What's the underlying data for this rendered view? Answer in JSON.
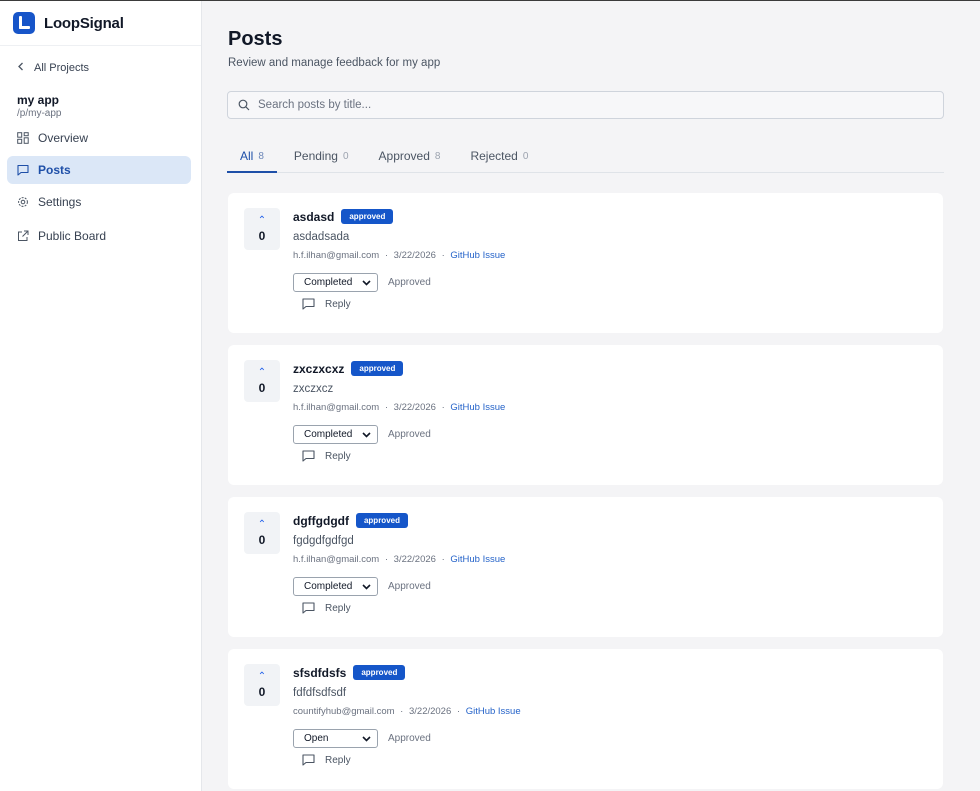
{
  "brand": {
    "name": "LoopSignal",
    "accent": "#1755c9"
  },
  "sidebar": {
    "back_label": "All Projects",
    "project_name": "my app",
    "project_path": "/p/my-app",
    "items": [
      {
        "label": "Overview",
        "icon": "grid-icon"
      },
      {
        "label": "Posts",
        "icon": "message-square-icon"
      },
      {
        "label": "Settings",
        "icon": "gear-icon"
      },
      {
        "label": "Public Board",
        "icon": "external-link-icon"
      }
    ]
  },
  "header": {
    "title": "Posts",
    "subtitle": "Review and manage feedback for my app"
  },
  "search": {
    "placeholder": "Search posts by title..."
  },
  "tabs": [
    {
      "label": "All",
      "count": "8"
    },
    {
      "label": "Pending",
      "count": "0"
    },
    {
      "label": "Approved",
      "count": "8"
    },
    {
      "label": "Rejected",
      "count": "0"
    }
  ],
  "posts": [
    {
      "votes": "0",
      "title": "asdasd",
      "badge": "approved",
      "body": "asdadsada",
      "author": "h.f.ilhan@gmail.com",
      "date": "3/22/2026",
      "link": "GitHub Issue",
      "status": "Completed",
      "approval": "Approved",
      "reply": "Reply"
    },
    {
      "votes": "0",
      "title": "zxczxcxz",
      "badge": "approved",
      "body": "zxczxcz",
      "author": "h.f.ilhan@gmail.com",
      "date": "3/22/2026",
      "link": "GitHub Issue",
      "status": "Completed",
      "approval": "Approved",
      "reply": "Reply"
    },
    {
      "votes": "0",
      "title": "dgffgdgdf",
      "badge": "approved",
      "body": "fgdgdfgdfgd",
      "author": "h.f.ilhan@gmail.com",
      "date": "3/22/2026",
      "link": "GitHub Issue",
      "status": "Completed",
      "approval": "Approved",
      "reply": "Reply"
    },
    {
      "votes": "0",
      "title": "sfsdfdsfs",
      "badge": "approved",
      "body": "fdfdfsdfsdf",
      "author": "countifyhub@gmail.com",
      "date": "3/22/2026",
      "link": "GitHub Issue",
      "status": "Open",
      "approval": "Approved",
      "reply": "Reply"
    }
  ],
  "meta_separator": "·"
}
